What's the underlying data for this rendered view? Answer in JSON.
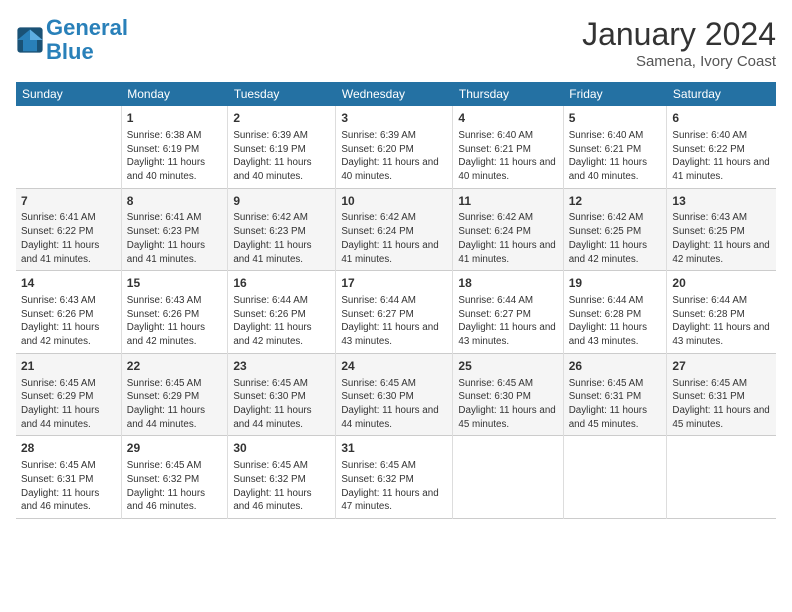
{
  "logo": {
    "line1": "General",
    "line2": "Blue"
  },
  "title": "January 2024",
  "subtitle": "Samena, Ivory Coast",
  "headers": [
    "Sunday",
    "Monday",
    "Tuesday",
    "Wednesday",
    "Thursday",
    "Friday",
    "Saturday"
  ],
  "weeks": [
    [
      {
        "day": "",
        "text": ""
      },
      {
        "day": "1",
        "text": "Sunrise: 6:38 AM\nSunset: 6:19 PM\nDaylight: 11 hours and 40 minutes."
      },
      {
        "day": "2",
        "text": "Sunrise: 6:39 AM\nSunset: 6:19 PM\nDaylight: 11 hours and 40 minutes."
      },
      {
        "day": "3",
        "text": "Sunrise: 6:39 AM\nSunset: 6:20 PM\nDaylight: 11 hours and 40 minutes."
      },
      {
        "day": "4",
        "text": "Sunrise: 6:40 AM\nSunset: 6:21 PM\nDaylight: 11 hours and 40 minutes."
      },
      {
        "day": "5",
        "text": "Sunrise: 6:40 AM\nSunset: 6:21 PM\nDaylight: 11 hours and 40 minutes."
      },
      {
        "day": "6",
        "text": "Sunrise: 6:40 AM\nSunset: 6:22 PM\nDaylight: 11 hours and 41 minutes."
      }
    ],
    [
      {
        "day": "7",
        "text": "Sunrise: 6:41 AM\nSunset: 6:22 PM\nDaylight: 11 hours and 41 minutes."
      },
      {
        "day": "8",
        "text": "Sunrise: 6:41 AM\nSunset: 6:23 PM\nDaylight: 11 hours and 41 minutes."
      },
      {
        "day": "9",
        "text": "Sunrise: 6:42 AM\nSunset: 6:23 PM\nDaylight: 11 hours and 41 minutes."
      },
      {
        "day": "10",
        "text": "Sunrise: 6:42 AM\nSunset: 6:24 PM\nDaylight: 11 hours and 41 minutes."
      },
      {
        "day": "11",
        "text": "Sunrise: 6:42 AM\nSunset: 6:24 PM\nDaylight: 11 hours and 41 minutes."
      },
      {
        "day": "12",
        "text": "Sunrise: 6:42 AM\nSunset: 6:25 PM\nDaylight: 11 hours and 42 minutes."
      },
      {
        "day": "13",
        "text": "Sunrise: 6:43 AM\nSunset: 6:25 PM\nDaylight: 11 hours and 42 minutes."
      }
    ],
    [
      {
        "day": "14",
        "text": "Sunrise: 6:43 AM\nSunset: 6:26 PM\nDaylight: 11 hours and 42 minutes."
      },
      {
        "day": "15",
        "text": "Sunrise: 6:43 AM\nSunset: 6:26 PM\nDaylight: 11 hours and 42 minutes."
      },
      {
        "day": "16",
        "text": "Sunrise: 6:44 AM\nSunset: 6:26 PM\nDaylight: 11 hours and 42 minutes."
      },
      {
        "day": "17",
        "text": "Sunrise: 6:44 AM\nSunset: 6:27 PM\nDaylight: 11 hours and 43 minutes."
      },
      {
        "day": "18",
        "text": "Sunrise: 6:44 AM\nSunset: 6:27 PM\nDaylight: 11 hours and 43 minutes."
      },
      {
        "day": "19",
        "text": "Sunrise: 6:44 AM\nSunset: 6:28 PM\nDaylight: 11 hours and 43 minutes."
      },
      {
        "day": "20",
        "text": "Sunrise: 6:44 AM\nSunset: 6:28 PM\nDaylight: 11 hours and 43 minutes."
      }
    ],
    [
      {
        "day": "21",
        "text": "Sunrise: 6:45 AM\nSunset: 6:29 PM\nDaylight: 11 hours and 44 minutes."
      },
      {
        "day": "22",
        "text": "Sunrise: 6:45 AM\nSunset: 6:29 PM\nDaylight: 11 hours and 44 minutes."
      },
      {
        "day": "23",
        "text": "Sunrise: 6:45 AM\nSunset: 6:30 PM\nDaylight: 11 hours and 44 minutes."
      },
      {
        "day": "24",
        "text": "Sunrise: 6:45 AM\nSunset: 6:30 PM\nDaylight: 11 hours and 44 minutes."
      },
      {
        "day": "25",
        "text": "Sunrise: 6:45 AM\nSunset: 6:30 PM\nDaylight: 11 hours and 45 minutes."
      },
      {
        "day": "26",
        "text": "Sunrise: 6:45 AM\nSunset: 6:31 PM\nDaylight: 11 hours and 45 minutes."
      },
      {
        "day": "27",
        "text": "Sunrise: 6:45 AM\nSunset: 6:31 PM\nDaylight: 11 hours and 45 minutes."
      }
    ],
    [
      {
        "day": "28",
        "text": "Sunrise: 6:45 AM\nSunset: 6:31 PM\nDaylight: 11 hours and 46 minutes."
      },
      {
        "day": "29",
        "text": "Sunrise: 6:45 AM\nSunset: 6:32 PM\nDaylight: 11 hours and 46 minutes."
      },
      {
        "day": "30",
        "text": "Sunrise: 6:45 AM\nSunset: 6:32 PM\nDaylight: 11 hours and 46 minutes."
      },
      {
        "day": "31",
        "text": "Sunrise: 6:45 AM\nSunset: 6:32 PM\nDaylight: 11 hours and 47 minutes."
      },
      {
        "day": "",
        "text": ""
      },
      {
        "day": "",
        "text": ""
      },
      {
        "day": "",
        "text": ""
      }
    ]
  ]
}
